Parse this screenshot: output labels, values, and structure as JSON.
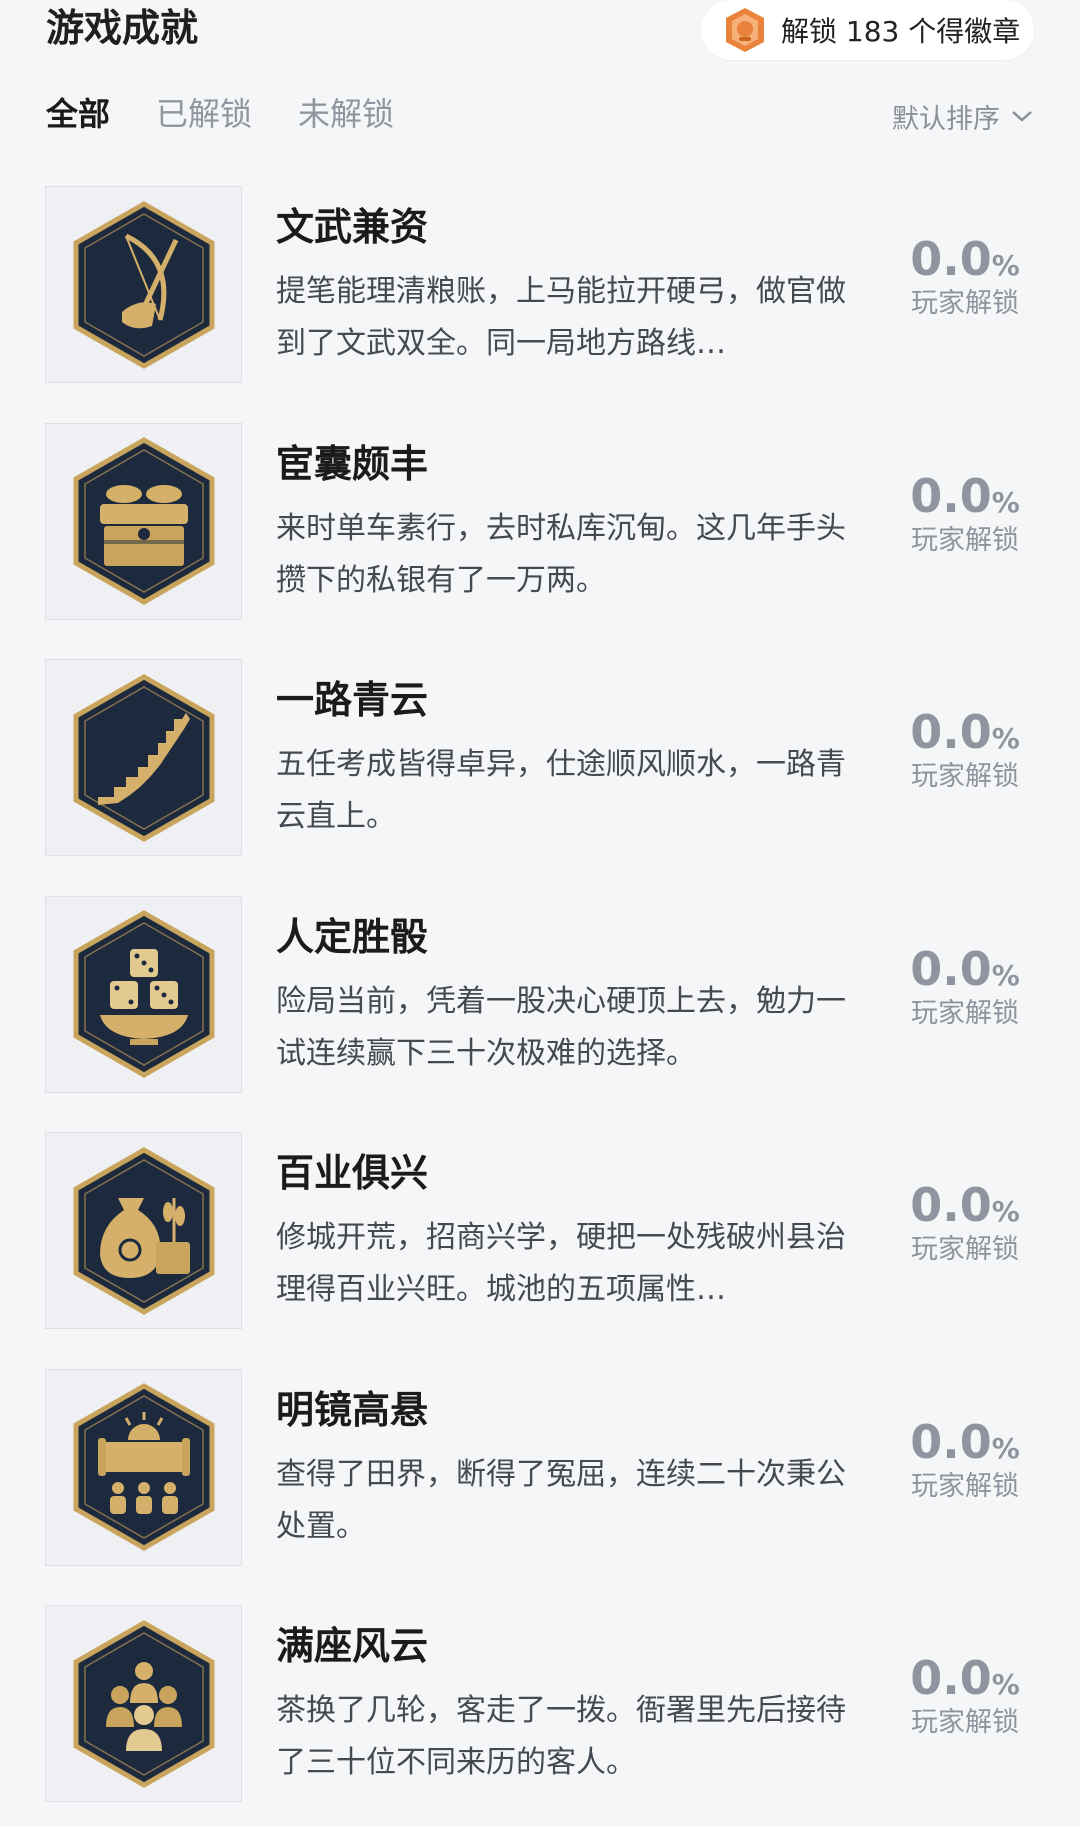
{
  "header": {
    "title": "游戏成就",
    "unlock_text": "解锁 183 个得徽章"
  },
  "tabs": [
    {
      "label": "全部",
      "active": true
    },
    {
      "label": "已解锁",
      "active": false
    },
    {
      "label": "未解锁",
      "active": false
    }
  ],
  "sort": {
    "label": "默认排序"
  },
  "colors": {
    "badge_bg": "#1d2a3e",
    "badge_gold": "#c9a45c",
    "page_bg": "#f5f6f8"
  },
  "achievements": [
    {
      "name": "文武兼资",
      "desc": "提笔能理清粮账，上马能拉开硬弓，做官做到了文武双全。同一局地方路线…",
      "pct": "0.0",
      "pct_unit": "%",
      "label": "玩家解锁",
      "icon": "bow-brush-icon"
    },
    {
      "name": "宦囊颇丰",
      "desc": "来时单车素行，去时私库沉甸。这几年手头攒下的私银有了一万两。",
      "pct": "0.0",
      "pct_unit": "%",
      "label": "玩家解锁",
      "icon": "treasure-chest-icon"
    },
    {
      "name": "一路青云",
      "desc": "五任考成皆得卓异，仕途顺风顺水，一路青云直上。",
      "pct": "0.0",
      "pct_unit": "%",
      "label": "玩家解锁",
      "icon": "stairs-icon"
    },
    {
      "name": "人定胜骰",
      "desc": "险局当前，凭着一股决心硬顶上去，勉力一试连续赢下三十次极难的选择。",
      "pct": "0.0",
      "pct_unit": "%",
      "label": "玩家解锁",
      "icon": "dice-bowl-icon"
    },
    {
      "name": "百业俱兴",
      "desc": "修城开荒，招商兴学，硬把一处残破州县治理得百业兴旺。城池的五项属性…",
      "pct": "0.0",
      "pct_unit": "%",
      "label": "玩家解锁",
      "icon": "money-bag-icon"
    },
    {
      "name": "明镜高悬",
      "desc": "查得了田界，断得了冤屈，连续二十次秉公处置。",
      "pct": "0.0",
      "pct_unit": "%",
      "label": "玩家解锁",
      "icon": "scroll-sun-icon"
    },
    {
      "name": "满座风云",
      "desc": "茶换了几轮，客走了一拨。衙署里先后接待了三十位不同来历的客人。",
      "pct": "0.0",
      "pct_unit": "%",
      "label": "玩家解锁",
      "icon": "guests-icon"
    }
  ]
}
